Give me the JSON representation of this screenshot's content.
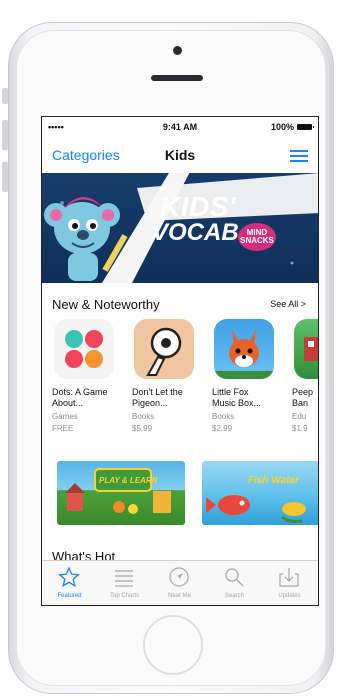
{
  "status_bar": {
    "signal": "•••••",
    "time": "9:41 AM",
    "battery": "100%"
  },
  "nav": {
    "back_label": "Categories",
    "title": "Kids"
  },
  "banner": {
    "headline_1": "KIDS'",
    "headline_2": "VOCAB",
    "badge": "MIND SNACKS"
  },
  "section": {
    "title": "New & Noteworthy",
    "see_all": "See All >"
  },
  "apps": [
    {
      "name": "Dots: A Game\nAbout...",
      "category": "Games",
      "price": "FREE"
    },
    {
      "name": "Don't Let the\nPigeon...",
      "category": "Books",
      "price": "$5.99"
    },
    {
      "name": "Little Fox\nMusic Box...",
      "category": "Books",
      "price": "$2.99"
    },
    {
      "name": "Peep\nBan",
      "category": "Edu",
      "price": "$1.9"
    }
  ],
  "promos": [
    {
      "label": "PLAY & LEARN"
    },
    {
      "label": "Fish Water"
    }
  ],
  "second_section": {
    "title": "What's Hot"
  },
  "tabbar": {
    "tabs": [
      {
        "label": "Featured",
        "icon": "star-icon"
      },
      {
        "label": "Top Charts",
        "icon": "list-icon"
      },
      {
        "label": "Near Me",
        "icon": "location-icon"
      },
      {
        "label": "Search",
        "icon": "search-icon"
      },
      {
        "label": "Updates",
        "icon": "download-icon"
      }
    ]
  },
  "colors": {
    "accent": "#1a82fb",
    "banner": "#173d6d",
    "badge": "#d42d7b"
  }
}
